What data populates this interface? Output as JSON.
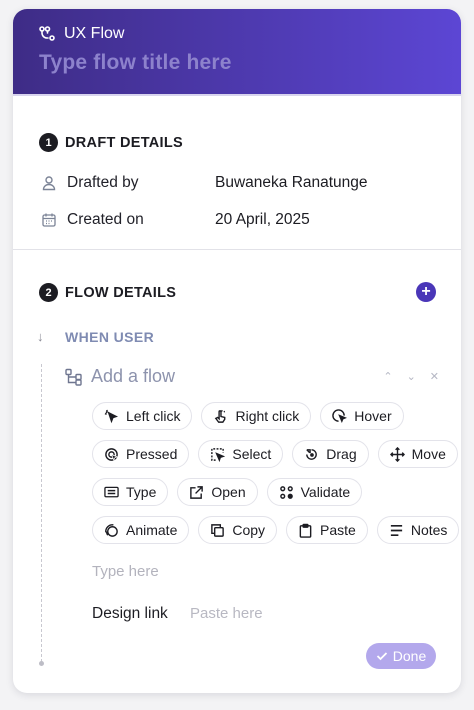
{
  "header": {
    "app_name": "UX Flow",
    "flow_title_placeholder": "Type flow title here"
  },
  "draft_details": {
    "number": "1",
    "title": "DRAFT DETAILS",
    "drafted_by_label": "Drafted by",
    "drafted_by_value": "Buwaneka Ranatunge",
    "created_on_label": "Created on",
    "created_on_value": "20 April, 2025"
  },
  "flow_details": {
    "number": "2",
    "title": "FLOW DETAILS",
    "add_symbol": "+",
    "down_arrow": "↓",
    "when_user": "WHEN USER",
    "add_flow_label": "Add a flow",
    "controls": {
      "up": "⌃",
      "down": "⌄",
      "close": "✕"
    },
    "actions": [
      [
        "Left click",
        "Right click",
        "Hover"
      ],
      [
        "Pressed",
        "Select",
        "Drag",
        "Move"
      ],
      [
        "Type",
        "Open",
        "Validate"
      ],
      [
        "Animate",
        "Copy",
        "Paste",
        "Notes"
      ]
    ],
    "type_placeholder": "Type here",
    "design_link_label": "Design link",
    "design_link_placeholder": "Paste here",
    "done_label": "Done"
  },
  "colors": {
    "header_gradient_start": "#3e2c86",
    "header_gradient_end": "#5c46d4",
    "accent": "#4a36b8",
    "done_button": "#b3a8ec"
  }
}
